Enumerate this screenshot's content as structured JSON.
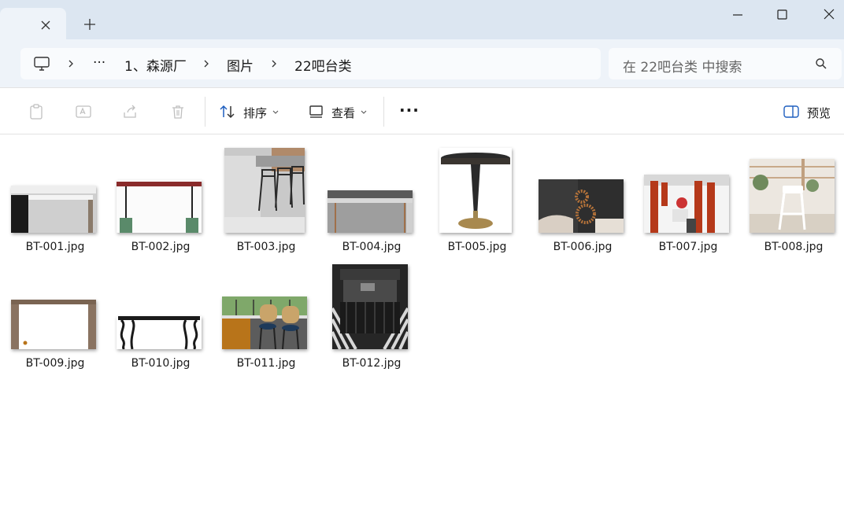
{
  "tab": {
    "close_label": "close tab",
    "new_label": "new tab"
  },
  "window": {
    "minimize": "minimize",
    "maximize": "maximize",
    "close": "close"
  },
  "address": {
    "overflow": "···",
    "crumbs": [
      "1、森源厂",
      "图片",
      "22吧台类"
    ]
  },
  "search": {
    "placeholder": "在 22吧台类 中搜索"
  },
  "toolbar": {
    "sort_label": "排序",
    "view_label": "查看",
    "more_label": "···",
    "preview_label": "预览"
  },
  "files": [
    {
      "name": "BT-001.jpg"
    },
    {
      "name": "BT-002.jpg"
    },
    {
      "name": "BT-003.jpg"
    },
    {
      "name": "BT-004.jpg"
    },
    {
      "name": "BT-005.jpg"
    },
    {
      "name": "BT-006.jpg"
    },
    {
      "name": "BT-007.jpg"
    },
    {
      "name": "BT-008.jpg"
    },
    {
      "name": "BT-009.jpg"
    },
    {
      "name": "BT-010.jpg"
    },
    {
      "name": "BT-011.jpg"
    },
    {
      "name": "BT-012.jpg"
    }
  ],
  "colors": {
    "titlebar": "#dce6f1",
    "addressbar": "#eef3f9",
    "accent": "#1f5fbf"
  }
}
